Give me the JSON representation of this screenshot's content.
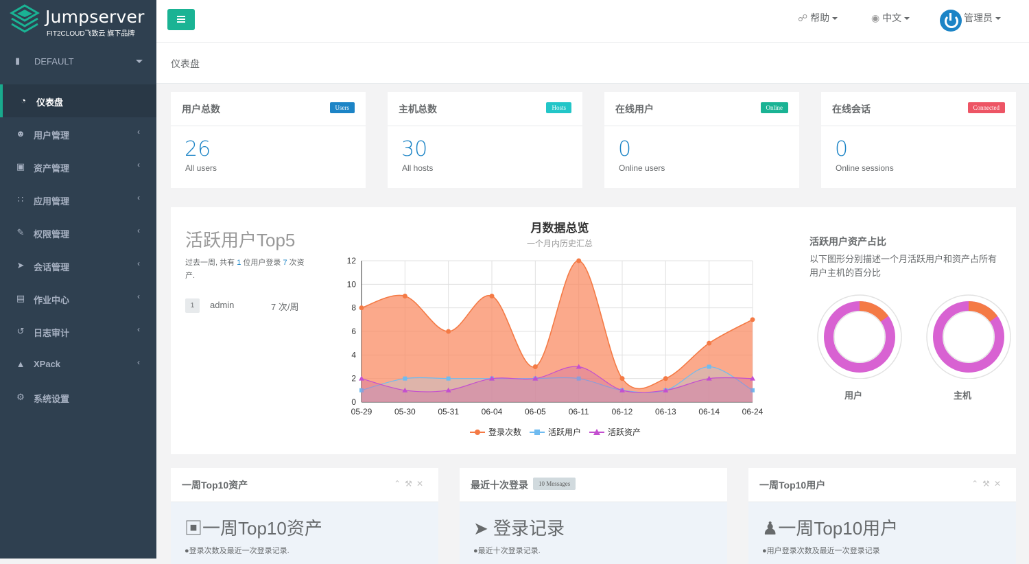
{
  "brand": {
    "title": "Jumpserver",
    "subtitle": "FIT2CLOUD飞致云 旗下品牌"
  },
  "org": {
    "label": "DEFAULT"
  },
  "nav": [
    {
      "label": "仪表盘",
      "icon": "dashboard-icon",
      "active": true
    },
    {
      "label": "用户管理",
      "icon": "users-icon"
    },
    {
      "label": "资产管理",
      "icon": "inbox-icon"
    },
    {
      "label": "应用管理",
      "icon": "grid-icon"
    },
    {
      "label": "权限管理",
      "icon": "edit-icon"
    },
    {
      "label": "会话管理",
      "icon": "rocket-icon"
    },
    {
      "label": "作业中心",
      "icon": "server-icon"
    },
    {
      "label": "日志审计",
      "icon": "history-icon"
    },
    {
      "label": "XPack",
      "icon": "sitemap-icon"
    },
    {
      "label": "系统设置",
      "icon": "cogs-icon"
    }
  ],
  "topbar": {
    "help": "帮助",
    "lang": "中文",
    "user": "管理员"
  },
  "breadcrumb": "仪表盘",
  "cards": [
    {
      "title": "用户总数",
      "badge": "Users",
      "badge_color": "#1c84c6",
      "value": "26",
      "sub": "All users"
    },
    {
      "title": "主机总数",
      "badge": "Hosts",
      "badge_color": "#23c6c8",
      "value": "30",
      "sub": "All hosts"
    },
    {
      "title": "在线用户",
      "badge": "Online",
      "badge_color": "#1ab394",
      "value": "0",
      "sub": "Online users"
    },
    {
      "title": "在线会话",
      "badge": "Connected",
      "badge_color": "#ed5565",
      "value": "0",
      "sub": "Online sessions"
    }
  ],
  "top5": {
    "title": "活跃用户Top5",
    "desc_prefix": "过去一周, 共有",
    "desc_users": "1",
    "desc_mid": "位用户登录",
    "desc_assets": "7",
    "desc_suffix": "次资产.",
    "rows": [
      {
        "rank": "1",
        "name": "admin",
        "count": "7 次/周"
      }
    ]
  },
  "pie": {
    "title": "活跃用户资产占比",
    "desc": "以下图形分别描述一个月活跃用户和资产占所有用户主机的百分比",
    "labels": [
      "用户",
      "主机"
    ],
    "values": [
      {
        "active_fraction": 0.15,
        "rest_fraction": 0.85
      },
      {
        "active_fraction": 0.15,
        "rest_fraction": 0.85
      }
    ],
    "colors": [
      "#f47a45",
      "#d862d2"
    ]
  },
  "chart_data": {
    "type": "area",
    "title": "月数据总览",
    "subtitle": "一个月内历史汇总",
    "categories": [
      "05-29",
      "05-30",
      "05-31",
      "06-04",
      "06-05",
      "06-11",
      "06-12",
      "06-13",
      "06-14",
      "06-24"
    ],
    "ylim": [
      0,
      12
    ],
    "yticks": [
      0,
      2,
      4,
      6,
      8,
      10,
      12
    ],
    "grid": true,
    "legend": "bottom",
    "series": [
      {
        "name": "登录次数",
        "color": "#f47a45",
        "values": [
          8,
          9,
          6,
          9,
          3,
          12,
          2,
          2,
          5,
          7
        ]
      },
      {
        "name": "活跃用户",
        "color": "#6fbbf0",
        "values": [
          1,
          2,
          2,
          2,
          2,
          2,
          1,
          1,
          3,
          1
        ]
      },
      {
        "name": "活跃资产",
        "color": "#c34fcf",
        "values": [
          2,
          1,
          1,
          2,
          2,
          3,
          1,
          1,
          2,
          2
        ]
      }
    ]
  },
  "boxes": [
    {
      "title": "一周Top10资产",
      "big": "一周Top10资产",
      "small": "登录次数及最近一次登录记录.",
      "icon": "inbox-icon",
      "tools": true
    },
    {
      "title": "最近十次登录",
      "badge": "10 Messages",
      "big": "登录记录",
      "small": "最近十次登录记录.",
      "icon": "paper-plane-icon"
    },
    {
      "title": "一周Top10用户",
      "big": "一周Top10用户",
      "small": "用户登录次数及最近一次登录记录",
      "icon": "user-icon",
      "tools": true
    }
  ]
}
